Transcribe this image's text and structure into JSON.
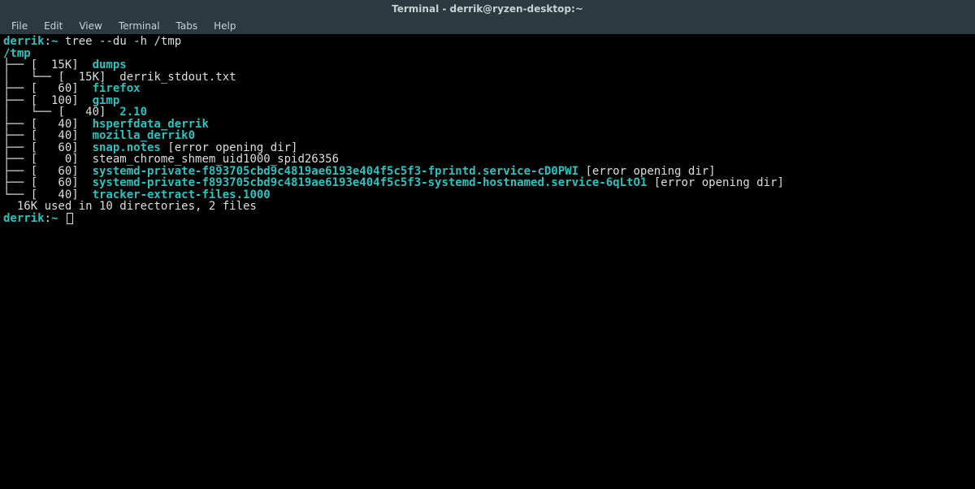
{
  "window": {
    "title": "Terminal - derrik@ryzen-desktop:~"
  },
  "menu": {
    "items": [
      "File",
      "Edit",
      "View",
      "Terminal",
      "Tabs",
      "Help"
    ]
  },
  "prompt": {
    "user": "derrik",
    "sep": ":",
    "path": "~",
    "command": "tree --du -h /tmp"
  },
  "tree": {
    "root": "/tmp",
    "lines": [
      {
        "prefix": "├── ",
        "size": "[  15K]",
        "name": "dumps",
        "is_dir": true
      },
      {
        "prefix": "│   └── ",
        "size": "[  15K]",
        "name": "derrik_stdout.txt",
        "is_dir": false
      },
      {
        "prefix": "├── ",
        "size": "[   60]",
        "name": "firefox",
        "is_dir": true
      },
      {
        "prefix": "├── ",
        "size": "[  100]",
        "name": "gimp",
        "is_dir": true
      },
      {
        "prefix": "│   └── ",
        "size": "[   40]",
        "name": "2.10",
        "is_dir": true
      },
      {
        "prefix": "├── ",
        "size": "[   40]",
        "name": "hsperfdata_derrik",
        "is_dir": true
      },
      {
        "prefix": "├── ",
        "size": "[   40]",
        "name": "mozilla_derrik0",
        "is_dir": true
      },
      {
        "prefix": "├── ",
        "size": "[   60]",
        "name": "snap.notes",
        "is_dir": true,
        "extra": " [error opening dir]"
      },
      {
        "prefix": "├── ",
        "size": "[    0]",
        "name": "steam_chrome_shmem_uid1000_spid26356",
        "is_dir": false
      },
      {
        "prefix": "├── ",
        "size": "[   60]",
        "name": "systemd-private-f893705cbd9c4819ae6193e404f5c5f3-fprintd.service-cD0PWI",
        "is_dir": true,
        "extra": " [error opening dir]"
      },
      {
        "prefix": "├── ",
        "size": "[   60]",
        "name": "systemd-private-f893705cbd9c4819ae6193e404f5c5f3-systemd-hostnamed.service-6qLtO1",
        "is_dir": true,
        "extra": " [error opening dir]"
      },
      {
        "prefix": "└── ",
        "size": "[   40]",
        "name": "tracker-extract-files.1000",
        "is_dir": true
      }
    ],
    "summary": "  16K used in 10 directories, 2 files"
  },
  "prompt2": {
    "user": "derrik",
    "sep": ":",
    "path": "~"
  }
}
